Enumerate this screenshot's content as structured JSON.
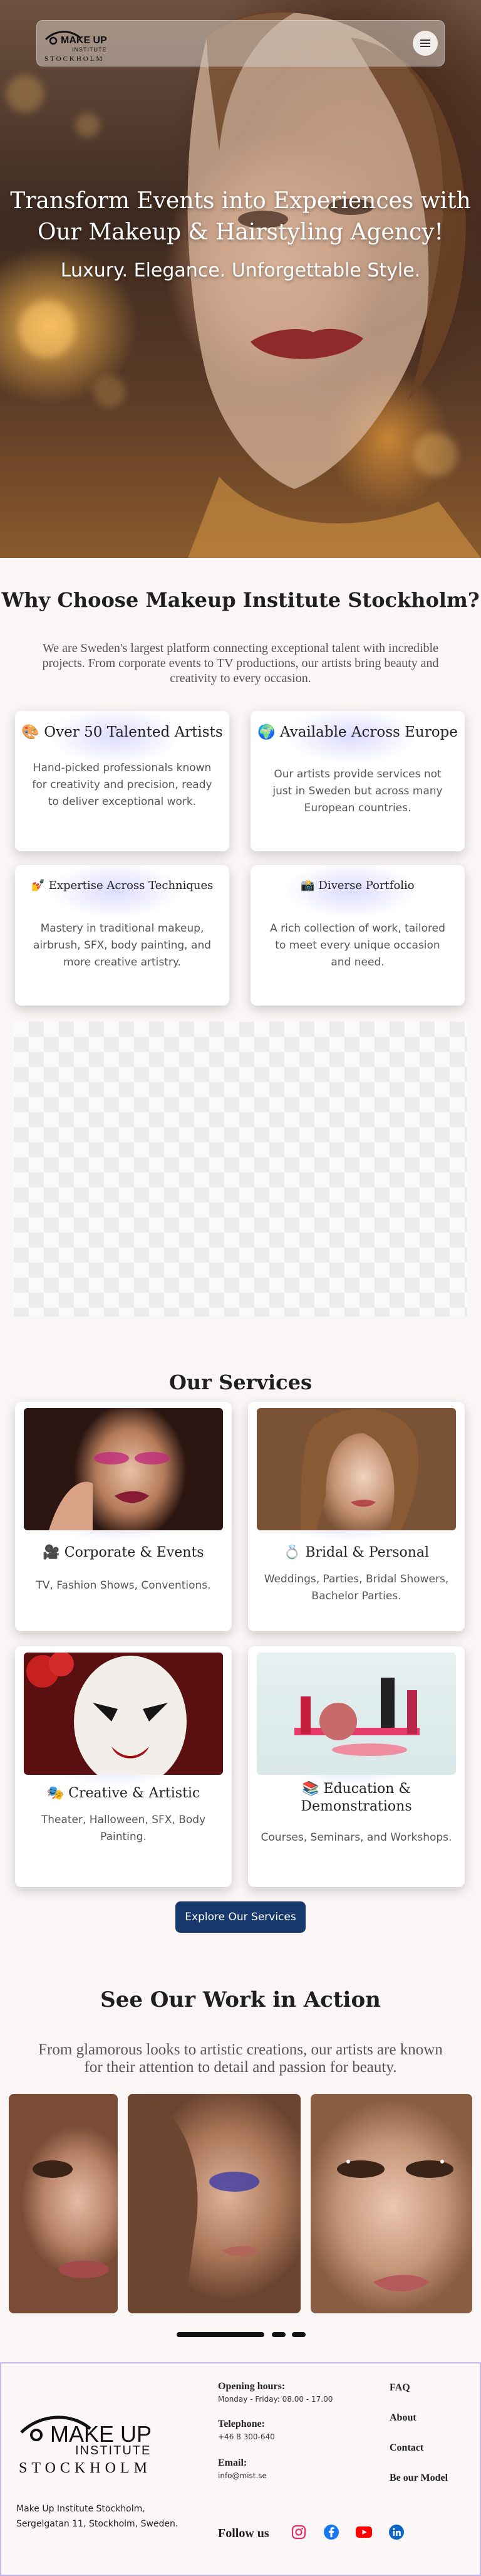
{
  "brand": {
    "logo_alt": "Make Up Institute Stockholm"
  },
  "hero": {
    "headline_line1": "Transform Events into Experiences with",
    "headline_line2": "Our Makeup & Hairstyling Agency!",
    "tagline": "Luxury. Elegance. Unforgettable Style."
  },
  "why": {
    "title": "Why Choose Makeup Institute Stockholm?",
    "intro": "We are Sweden's largest platform connecting exceptional talent with incredible projects. From corporate events to TV productions, our artists bring beauty and creativity to every occasion.",
    "features": [
      {
        "icon": "🎨",
        "title": "Over 50 Talented Artists",
        "text": "Hand-picked professionals known for creativity and precision, ready to deliver exceptional work."
      },
      {
        "icon": "🌍",
        "title": "Available Across Europe",
        "text": "Our artists provide services not just in Sweden but across many European countries."
      },
      {
        "icon": "💅",
        "title": "Expertise Across Techniques",
        "text": "Mastery in traditional makeup, airbrush, SFX, body painting, and more creative artistry."
      },
      {
        "icon": "📸",
        "title": "Diverse Portfolio",
        "text": "A rich collection of work, tailored to meet every unique occasion and need."
      }
    ]
  },
  "services": {
    "title": "Our Services",
    "items": [
      {
        "icon": "🎥",
        "title": "Corporate & Events",
        "text": "TV, Fashion Shows, Conventions."
      },
      {
        "icon": "💍",
        "title": "Bridal & Personal",
        "text": "Weddings, Parties, Bridal Showers, Bachelor Parties."
      },
      {
        "icon": "🎭",
        "title": "Creative & Artistic",
        "text": "Theater, Halloween, SFX, Body Painting."
      },
      {
        "icon": "📚",
        "title_line1": "Education &",
        "title_line2": "Demonstrations",
        "text": "Courses, Seminars, and Workshops."
      }
    ],
    "button": "Explore Our Services"
  },
  "work": {
    "title": "See Our Work in Action",
    "intro": "From glamorous looks to artistic creations, our artists are known for their attention to detail and passion for beauty."
  },
  "footer": {
    "logo_line1": "MAKE UP",
    "logo_line2": "INSTITUTE",
    "logo_line3": "STOCKHOLM",
    "address_line1": "Make Up Institute Stockholm,",
    "address_line2": "Sergelgatan 11, Stockholm, Sweden.",
    "hours_label": "Opening hours:",
    "hours_value": "Monday - Friday: 08.00 - 17.00",
    "phone_label": "Telephone:",
    "phone_value": "+46 8 300-640",
    "email_label": "Email:",
    "email_value": "info@mist.se",
    "follow_label": "Follow us",
    "links": [
      "FAQ",
      "About",
      "Contact",
      "Be our Model"
    ]
  },
  "colors": {
    "accent": "#16386d",
    "background": "#faf6f5",
    "instagram": "#e1306c",
    "facebook": "#1877f2",
    "youtube": "#ff0000",
    "linkedin": "#0a66c2"
  }
}
